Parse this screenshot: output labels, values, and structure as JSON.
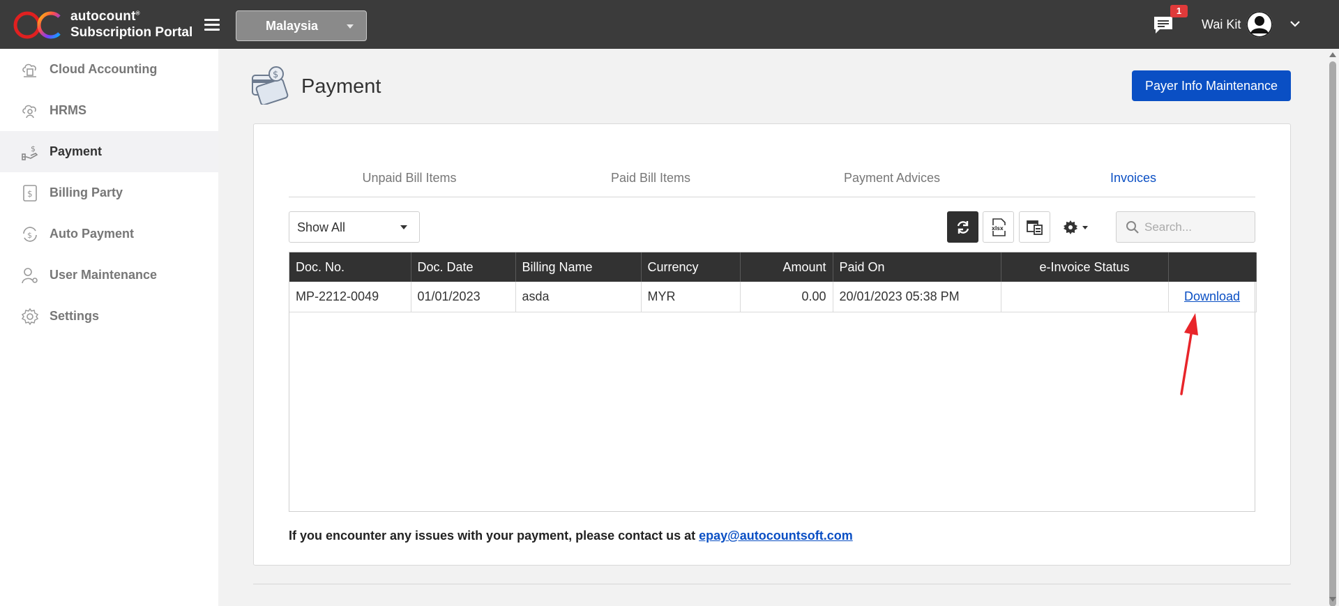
{
  "header": {
    "brand_top": "autocount",
    "brand_reg": "®",
    "brand_bottom": "Subscription Portal",
    "country": "Malaysia",
    "notification_count": "1",
    "username": "Wai Kit"
  },
  "sidebar": {
    "items": [
      {
        "label": "Cloud Accounting",
        "icon": "cloud-accounting-icon"
      },
      {
        "label": "HRMS",
        "icon": "hrms-icon"
      },
      {
        "label": "Payment",
        "icon": "payment-icon",
        "active": true
      },
      {
        "label": "Billing Party",
        "icon": "billing-party-icon"
      },
      {
        "label": "Auto Payment",
        "icon": "auto-payment-icon"
      },
      {
        "label": "User Maintenance",
        "icon": "user-maintenance-icon"
      },
      {
        "label": "Settings",
        "icon": "settings-icon"
      }
    ]
  },
  "page": {
    "title": "Payment",
    "payer_button": "Payer Info Maintenance"
  },
  "tabs": [
    {
      "label": "Unpaid Bill Items"
    },
    {
      "label": "Paid Bill Items"
    },
    {
      "label": "Payment Advices"
    },
    {
      "label": "Invoices",
      "active": true
    }
  ],
  "toolbar": {
    "filter": "Show All",
    "search_placeholder": "Search..."
  },
  "table": {
    "columns": [
      "Doc. No.",
      "Doc. Date",
      "Billing Name",
      "Currency",
      "Amount",
      "Paid On",
      "e-Invoice Status",
      ""
    ],
    "rows": [
      {
        "doc_no": "MP-2212-0049",
        "doc_date": "01/01/2023",
        "billing_name": "asda",
        "currency": "MYR",
        "amount": "0.00",
        "paid_on": "20/01/2023 05:38 PM",
        "einvoice_status": "",
        "action": "Download"
      }
    ]
  },
  "footer": {
    "note": "If you encounter any issues with your payment, please contact us at ",
    "email": "epay@autocountsoft.com"
  },
  "colors": {
    "topbar": "#3b3b3b",
    "accent": "#0a4fc4",
    "table_header": "#323232",
    "badge": "#e03a3a",
    "annotation_arrow": "#e8252a"
  }
}
